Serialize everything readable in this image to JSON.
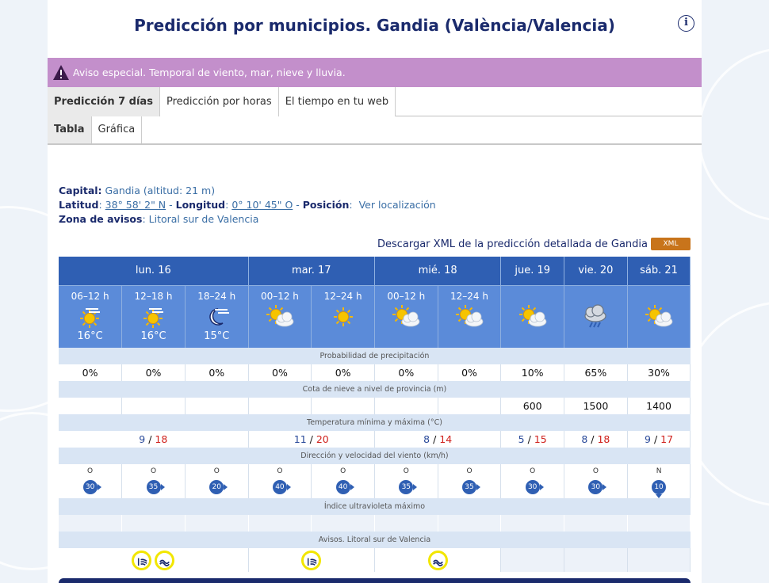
{
  "page": {
    "title": "Predicción por municipios. Gandia (València/Valencia)"
  },
  "alert": {
    "text": "Aviso especial. Temporal de viento, mar, nieve y lluvia."
  },
  "tabs_main": [
    {
      "label": "Predicción 7 días",
      "active": true
    },
    {
      "label": "Predicción por horas",
      "active": false
    },
    {
      "label": "El tiempo en tu web",
      "active": false
    }
  ],
  "tabs_sub": [
    {
      "label": "Tabla",
      "active": true
    },
    {
      "label": "Gráfica",
      "active": false
    }
  ],
  "location": {
    "capital_label": "Capital:",
    "capital_value": "Gandia (altitud: 21 m)",
    "lat_label": "Latitud",
    "lat_value": "38° 58' 2\" N",
    "lon_label": "Longitud",
    "lon_value": "0° 10' 45\" O",
    "pos_label": "Posición",
    "pos_link": "Ver localización",
    "zona_label": "Zona de avisos",
    "zona_value": "Litoral sur de Valencia"
  },
  "download": {
    "text": "Descargar XML de la predicción detallada de Gandia",
    "badge": "XML"
  },
  "days": [
    {
      "label": "lun. 16",
      "span": 3
    },
    {
      "label": "mar. 17",
      "span": 2
    },
    {
      "label": "mié. 18",
      "span": 2
    },
    {
      "label": "jue. 19",
      "span": 1
    },
    {
      "label": "vie. 20",
      "span": 1
    },
    {
      "label": "sáb. 21",
      "span": 1
    }
  ],
  "periods": [
    {
      "time": "06–12 h",
      "icon": "sun-wind-icon",
      "temp": "16°C"
    },
    {
      "time": "12–18 h",
      "icon": "sun-wind-icon",
      "temp": "16°C"
    },
    {
      "time": "18–24 h",
      "icon": "moon-wind-icon",
      "temp": "15°C"
    },
    {
      "time": "00–12 h",
      "icon": "sun-cloud-icon",
      "temp": ""
    },
    {
      "time": "12–24 h",
      "icon": "sun-icon",
      "temp": ""
    },
    {
      "time": "00–12 h",
      "icon": "sun-cloud-icon",
      "temp": ""
    },
    {
      "time": "12–24 h",
      "icon": "sun-cloud-icon",
      "temp": ""
    },
    {
      "time": "",
      "icon": "sun-cloud-icon",
      "temp": ""
    },
    {
      "time": "",
      "icon": "rain-cloud-icon",
      "temp": ""
    },
    {
      "time": "",
      "icon": "sun-cloud-icon",
      "temp": ""
    }
  ],
  "labels": {
    "precip": "Probabilidad de precipitación",
    "snow": "Cota de nieve a nivel de provincia (m)",
    "temp": "Temperatura mínima y máxima (°C)",
    "wind": "Dirección y velocidad del viento (km/h)",
    "uv": "Índice ultravioleta máximo",
    "avisos": "Avisos. Litoral sur de Valencia"
  },
  "precip": [
    "0%",
    "0%",
    "0%",
    "0%",
    "0%",
    "0%",
    "0%",
    "10%",
    "65%",
    "30%"
  ],
  "snow": [
    "",
    "",
    "",
    "",
    "",
    "",
    "",
    "600",
    "1500",
    "1400"
  ],
  "temps": [
    {
      "min": "9",
      "sep": " / ",
      "max": "18",
      "span": 3
    },
    {
      "min": "11",
      "sep": " / ",
      "max": "20",
      "span": 2
    },
    {
      "min": "8",
      "sep": " / ",
      "max": "14",
      "span": 2
    },
    {
      "min": "5",
      "sep": " / ",
      "max": "15",
      "span": 1
    },
    {
      "min": "8",
      "sep": " / ",
      "max": "18",
      "span": 1
    },
    {
      "min": "9",
      "sep": " / ",
      "max": "17",
      "span": 1
    }
  ],
  "wind": [
    {
      "dir": "O",
      "speed": "30",
      "arrow": "e"
    },
    {
      "dir": "O",
      "speed": "35",
      "arrow": "e"
    },
    {
      "dir": "O",
      "speed": "20",
      "arrow": "e"
    },
    {
      "dir": "O",
      "speed": "40",
      "arrow": "e"
    },
    {
      "dir": "O",
      "speed": "40",
      "arrow": "e"
    },
    {
      "dir": "O",
      "speed": "35",
      "arrow": "e"
    },
    {
      "dir": "O",
      "speed": "35",
      "arrow": "e"
    },
    {
      "dir": "O",
      "speed": "30",
      "arrow": "e"
    },
    {
      "dir": "O",
      "speed": "30",
      "arrow": "e"
    },
    {
      "dir": "N",
      "speed": "10",
      "arrow": "s"
    }
  ],
  "avisos": [
    {
      "span": 3,
      "icons": [
        "wind-warning-icon",
        "coastal-warning-icon"
      ]
    },
    {
      "span": 2,
      "icons": [
        "wind-warning-icon"
      ]
    },
    {
      "span": 2,
      "icons": [
        "coastal-warning-icon"
      ]
    },
    {
      "span": 1,
      "icons": []
    },
    {
      "span": 1,
      "icons": []
    },
    {
      "span": 1,
      "icons": []
    }
  ]
}
